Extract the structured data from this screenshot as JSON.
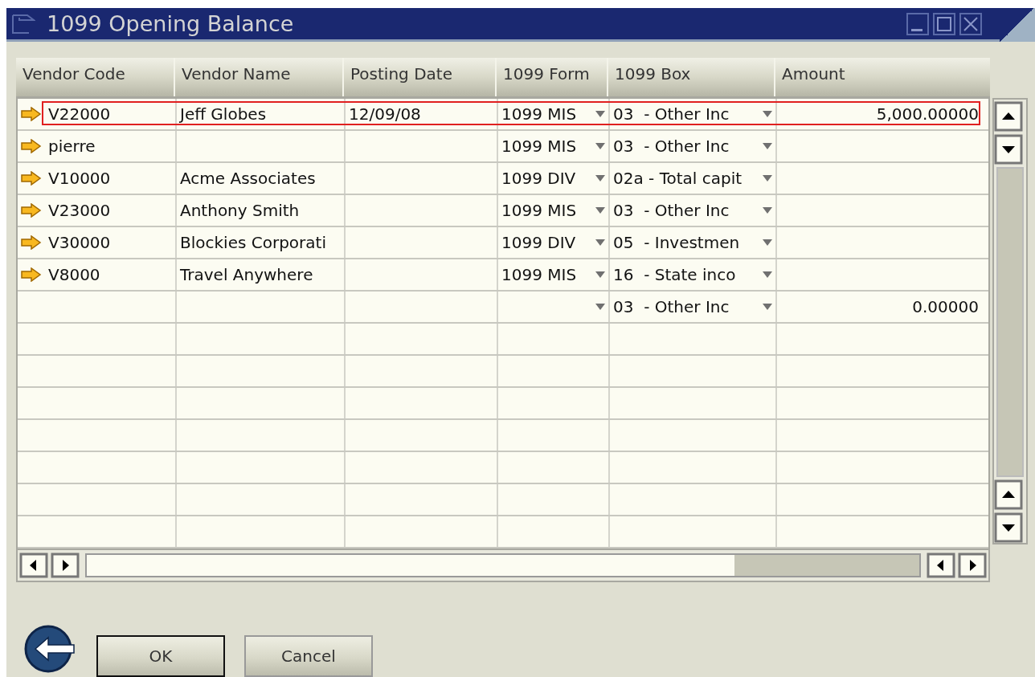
{
  "window": {
    "title": "1099 Opening Balance"
  },
  "table": {
    "columns": [
      "Vendor Code",
      "Vendor Name",
      "Posting Date",
      "1099 Form",
      "1099 Box",
      "Amount"
    ],
    "rows": [
      {
        "kind": "vendor",
        "selected": true,
        "code": "V22000",
        "name": "Jeff Globes",
        "date": "12/09/08",
        "form": "1099 MIS",
        "box": "03  - Other Inc",
        "amount": "5,000.00000"
      },
      {
        "kind": "vendor",
        "selected": false,
        "code": "pierre",
        "form": "1099 MIS",
        "box": "03  - Other Inc"
      },
      {
        "kind": "vendor",
        "selected": false,
        "code": "V10000",
        "name": "Acme Associates",
        "form": "1099 DIV",
        "box": "02a - Total capit"
      },
      {
        "kind": "vendor",
        "selected": false,
        "code": "V23000",
        "name": "Anthony Smith",
        "form": "1099 MIS",
        "box": "03  - Other Inc"
      },
      {
        "kind": "vendor",
        "selected": false,
        "code": "V30000",
        "name": "Blockies Corporati",
        "form": "1099 DIV",
        "box": "05  - Investmen"
      },
      {
        "kind": "vendor",
        "selected": false,
        "code": "V8000",
        "name": "Travel Anywhere",
        "form": "1099 MIS",
        "box": "16  - State inco"
      },
      {
        "kind": "new",
        "selected": false,
        "box": "03  - Other Inc",
        "amount": "0.00000"
      }
    ]
  },
  "buttons": [
    "OK",
    "Cancel"
  ]
}
